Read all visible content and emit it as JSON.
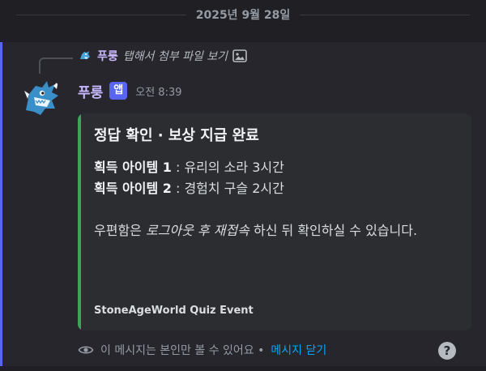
{
  "date_divider": "2025년 9월 28일",
  "reply": {
    "name": "푸룽",
    "text": "탭해서 첨부 파일 보기",
    "icon": "image-icon"
  },
  "message": {
    "author": "푸룽",
    "badge": "앱",
    "time": "오전 8:39"
  },
  "embed": {
    "title": "정답 확인 · 보상 지급 완료",
    "item1_label": "획득 아이템 1",
    "item1_value": " : 유리의 소라 3시간",
    "item2_label": "획득 아이템 2",
    "item2_value": " : 경험치 구슬 2시간",
    "notice_prefix": "우편함은 ",
    "notice_italic": "로그아웃 후 재접속",
    "notice_suffix": " 하신 뒤 확인하실 수 있습니다.",
    "footer": "StoneAgeWorld Quiz Event",
    "accent_color": "#3ba55c"
  },
  "ephemeral": {
    "text": "이 메시지는 본인만 볼 수 있어요 •",
    "dismiss": "메시지 닫기"
  },
  "help": "?"
}
